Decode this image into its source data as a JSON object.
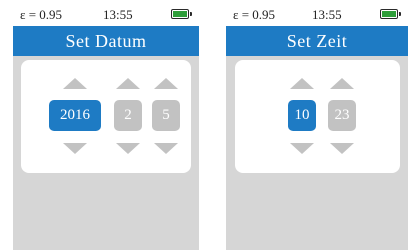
{
  "left_screen": {
    "status": {
      "emissivity": "ε = 0.95",
      "time": "13:55"
    },
    "title": "Set Datum",
    "values": [
      "2016",
      "2",
      "5"
    ]
  },
  "right_screen": {
    "status": {
      "emissivity": "ε = 0.95",
      "time": "13:55"
    },
    "title": "Set Zeit",
    "values": [
      "10",
      "23"
    ]
  },
  "colors": {
    "accent": "#1e7bc4",
    "inactive": "#c2c2c2",
    "background": "#d6d6d6",
    "battery": "#2e9e3a"
  },
  "battery_level": 1.0
}
